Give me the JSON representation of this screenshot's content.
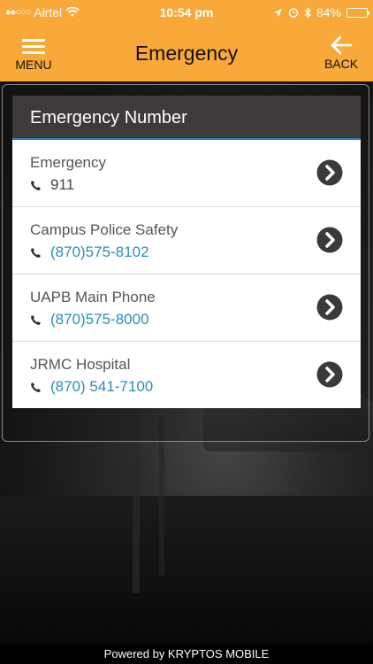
{
  "status_bar": {
    "signal_dots": "●●○○○",
    "carrier": "Airtel",
    "time": "10:54 pm",
    "battery_percent": "84%",
    "battery_level": 0.84
  },
  "nav": {
    "menu_label": "MENU",
    "title": "Emergency",
    "back_label": "BACK"
  },
  "card": {
    "header": "Emergency Number",
    "contacts": [
      {
        "name": "Emergency",
        "phone": "911"
      },
      {
        "name": "Campus Police Safety",
        "phone": "(870)575-8102"
      },
      {
        "name": "UAPB Main Phone",
        "phone": "(870)575-8000"
      },
      {
        "name": "JRMC Hospital",
        "phone": "(870) 541-7100"
      }
    ]
  },
  "footer": {
    "text": "Powered by KRYPTOS MOBILE"
  },
  "colors": {
    "accent": "#f9a83a",
    "header_bg": "#3e3a39",
    "link": "#2a8fb0",
    "divider": "#1f7fc4"
  },
  "icons": [
    "wifi-icon",
    "location-icon",
    "alarm-icon",
    "bluetooth-icon",
    "battery-icon",
    "menu-icon",
    "back-arrow-icon",
    "phone-icon",
    "chevron-right-icon"
  ]
}
